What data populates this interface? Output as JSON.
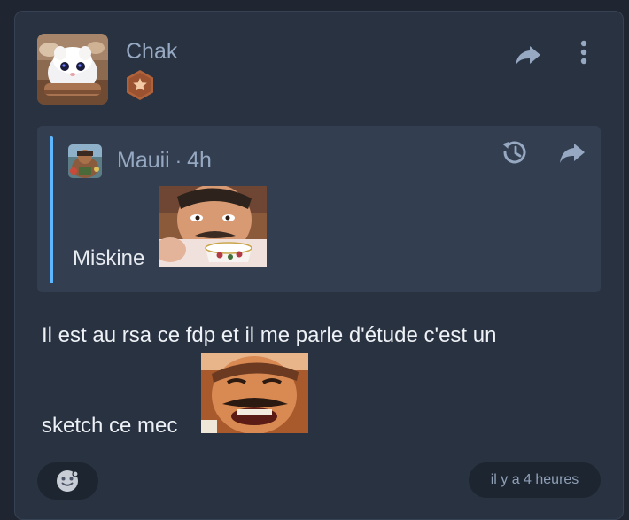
{
  "post": {
    "author": "Chak",
    "avatar_icon": "kitten-avatar",
    "badge_icon": "star-badge-icon",
    "badge_color": "#b0623a",
    "body_line1": "Il est au rsa ce fdp et il me parle d'étude c'est un",
    "body_line2": "sketch ce mec",
    "sticker_icon": "laughing-man-sticker",
    "timestamp": "il y a 4 heures"
  },
  "quote": {
    "author": "Mauii",
    "separator": "·",
    "time": "4h",
    "text": "Miskine",
    "sticker_icon": "man-drinking-tea-sticker",
    "accent_color": "#5fb8ff"
  },
  "actions": {
    "share_icon": "share-arrow-icon",
    "more_icon": "more-vertical-icon",
    "history_icon": "history-icon",
    "reaction_icon": "emoji-reaction-icon"
  }
}
